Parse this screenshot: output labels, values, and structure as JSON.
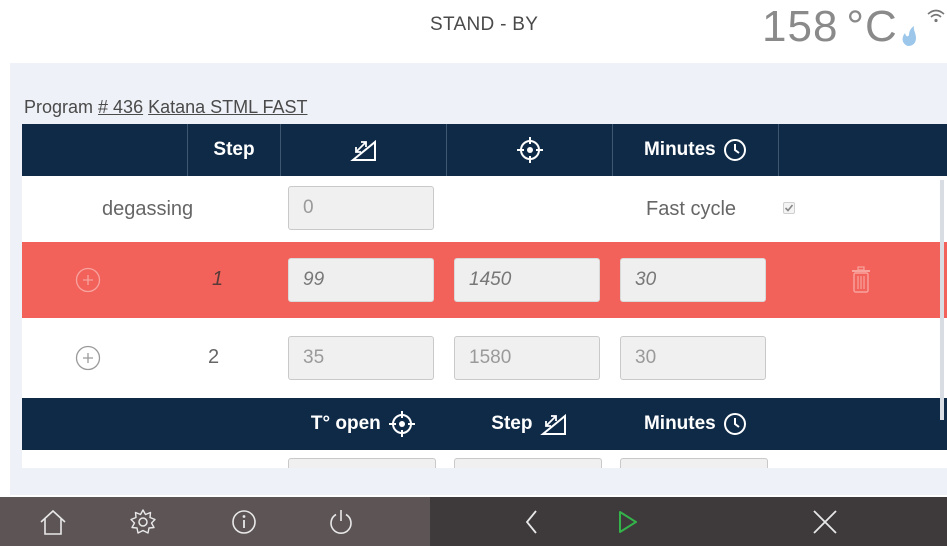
{
  "status": {
    "text": "STAND - BY"
  },
  "temperature": {
    "value": "158",
    "unit": "°C"
  },
  "program": {
    "prefix": "Program ",
    "number": "# 436",
    "name": "Katana STML FAST"
  },
  "table": {
    "header": {
      "step_label": "Step",
      "minutes_label": "Minutes"
    },
    "degassing": {
      "label": "degassing",
      "value": "0",
      "fast_cycle_label": "Fast cycle",
      "fast_cycle_checked": true
    },
    "rows": [
      {
        "step": "1",
        "rate": "99",
        "temp": "1450",
        "minutes": "30",
        "selected": true
      },
      {
        "step": "2",
        "rate": "35",
        "temp": "1580",
        "minutes": "30",
        "selected": false
      }
    ],
    "cooling_header": {
      "t_open_label": "T° open",
      "step_label": "Step",
      "minutes_label": "Minutes"
    }
  },
  "colors": {
    "header_bg": "#0f2a47",
    "selected_row": "#f2625a",
    "bottom_left": "#5d5456",
    "bottom_right": "#3e3a3b",
    "start_green": "#34b34a"
  },
  "icons": {
    "ramp": "ramp-icon",
    "target": "target-icon",
    "clock": "clock-icon",
    "home": "home-icon",
    "settings": "gear-icon",
    "info": "info-icon",
    "power": "power-icon",
    "back": "chevron-left-icon",
    "play": "play-icon",
    "close": "close-icon"
  }
}
